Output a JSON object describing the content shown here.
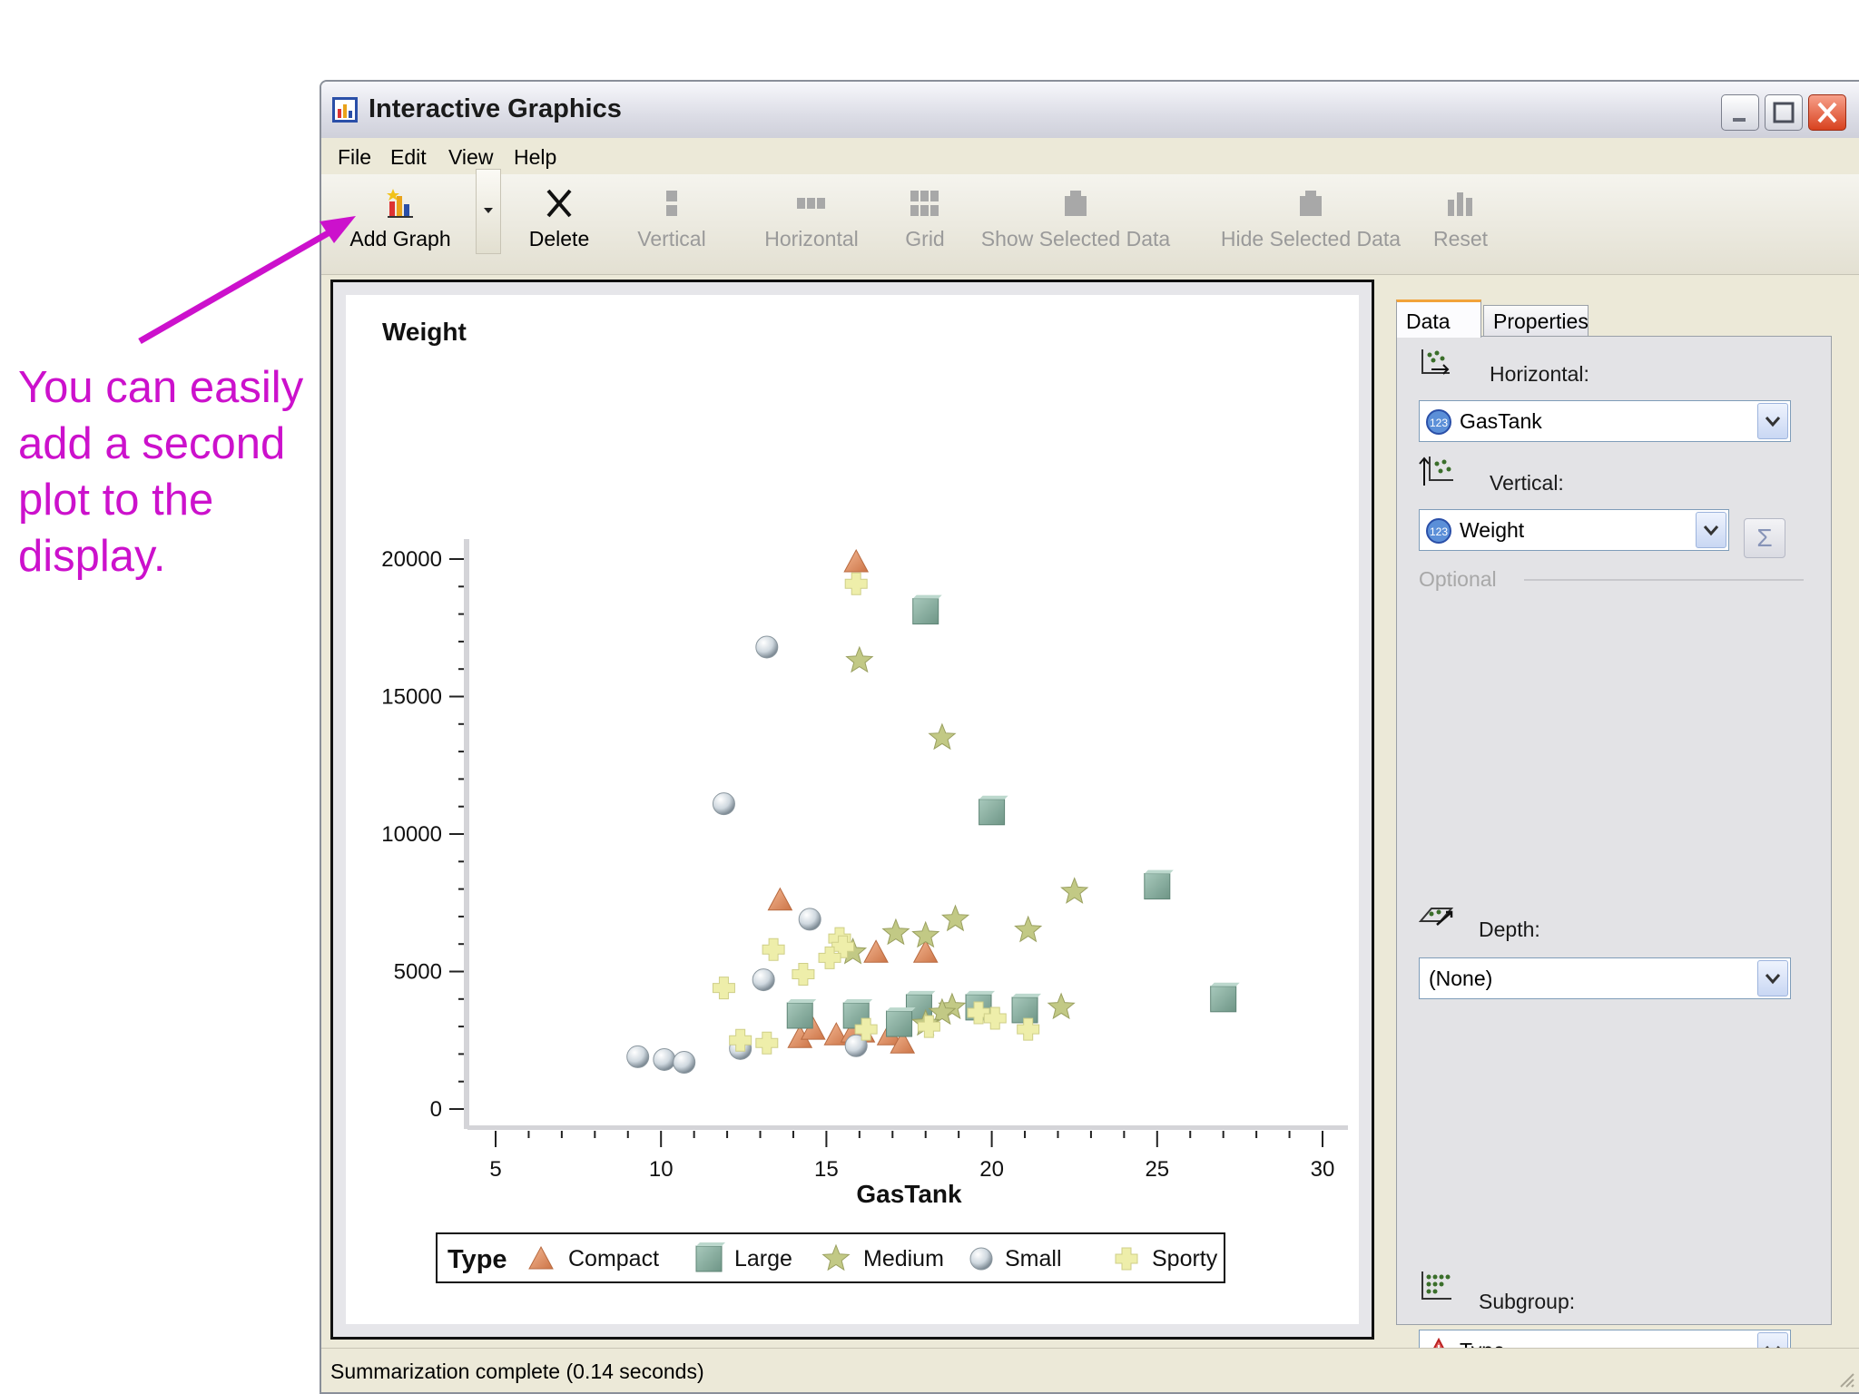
{
  "annotation": {
    "lines": [
      "You can easily",
      "add a second",
      "plot to the",
      "display."
    ]
  },
  "window": {
    "title": "Interactive Graphics"
  },
  "menu": {
    "items": [
      "File",
      "Edit",
      "View",
      "Help"
    ]
  },
  "toolbar": {
    "add_graph": "Add Graph",
    "delete": "Delete",
    "vertical": "Vertical",
    "horizontal": "Horizontal",
    "grid": "Grid",
    "show_selected": "Show Selected Data",
    "hide_selected": "Hide Selected Data",
    "reset": "Reset"
  },
  "tabs": {
    "data": "Data",
    "properties": "Properties"
  },
  "panel": {
    "horizontal_label": "Horizontal:",
    "horizontal_value": "GasTank",
    "vertical_label": "Vertical:",
    "vertical_value": "Weight",
    "sigma": "Σ",
    "optional_label": "Optional",
    "depth_label": "Depth:",
    "depth_value": "(None)",
    "subgroup_label": "Subgroup:",
    "subgroup_value": "Type"
  },
  "status": {
    "text": "Summarization complete (0.14 seconds)"
  },
  "colors": {
    "annotation": "#cc11cc",
    "compact": "#e8956b",
    "large": "#8fb5a8",
    "medium": "#c2c985",
    "small": "#d5dde3",
    "sporty": "#eeeeaa"
  },
  "chart_data": {
    "type": "scatter",
    "xlabel": "GasTank",
    "ylabel": "Weight",
    "xlim": [
      5,
      30
    ],
    "ylim": [
      0,
      20000
    ],
    "xticks": [
      5,
      10,
      15,
      20,
      25,
      30
    ],
    "yticks": [
      0,
      5000,
      10000,
      15000,
      20000
    ],
    "legend_title": "Type",
    "legend_position": "bottom",
    "series": [
      {
        "name": "Compact",
        "marker": "triangle",
        "color": "#e8956b",
        "points": [
          [
            15.9,
            19900
          ],
          [
            13.6,
            7600
          ],
          [
            16.5,
            5700
          ],
          [
            18,
            5700
          ],
          [
            14.2,
            2600
          ],
          [
            14.6,
            2900
          ],
          [
            15.3,
            2700
          ],
          [
            15.8,
            2800
          ],
          [
            16.9,
            2700
          ],
          [
            17.3,
            2400
          ],
          [
            16.1,
            2800
          ]
        ]
      },
      {
        "name": "Large",
        "marker": "square",
        "color": "#8fb5a8",
        "points": [
          [
            18,
            18100
          ],
          [
            20,
            10800
          ],
          [
            25,
            8100
          ],
          [
            27,
            4000
          ],
          [
            14.2,
            3400
          ],
          [
            15.9,
            3400
          ],
          [
            17.8,
            3700
          ],
          [
            19.6,
            3700
          ],
          [
            21,
            3600
          ],
          [
            17.2,
            3100
          ]
        ]
      },
      {
        "name": "Medium",
        "marker": "star",
        "color": "#c2c985",
        "points": [
          [
            16,
            16300
          ],
          [
            18.5,
            13500
          ],
          [
            22.5,
            7900
          ],
          [
            18.9,
            6900
          ],
          [
            21.1,
            6500
          ],
          [
            17.1,
            6400
          ],
          [
            18,
            6300
          ],
          [
            15.8,
            5700
          ],
          [
            18.8,
            3700
          ],
          [
            22.1,
            3700
          ],
          [
            18.5,
            3500
          ],
          [
            18,
            3100
          ]
        ]
      },
      {
        "name": "Small",
        "marker": "sphere",
        "color": "#d5dde3",
        "points": [
          [
            13.2,
            16800
          ],
          [
            11.9,
            11100
          ],
          [
            14.5,
            6900
          ],
          [
            13.1,
            4700
          ],
          [
            9.3,
            1900
          ],
          [
            10.1,
            1800
          ],
          [
            10.7,
            1700
          ],
          [
            12.4,
            2200
          ],
          [
            15.9,
            2300
          ]
        ]
      },
      {
        "name": "Sporty",
        "marker": "cross",
        "color": "#eeeeaa",
        "points": [
          [
            15.9,
            19100
          ],
          [
            15.4,
            6200
          ],
          [
            15.5,
            5900
          ],
          [
            13.4,
            5800
          ],
          [
            15.1,
            5500
          ],
          [
            14.3,
            4900
          ],
          [
            11.9,
            4400
          ],
          [
            12.4,
            2500
          ],
          [
            13.2,
            2400
          ],
          [
            18.1,
            3000
          ],
          [
            19.6,
            3500
          ],
          [
            20.1,
            3300
          ],
          [
            21.1,
            2900
          ],
          [
            16.2,
            2900
          ]
        ]
      }
    ]
  }
}
